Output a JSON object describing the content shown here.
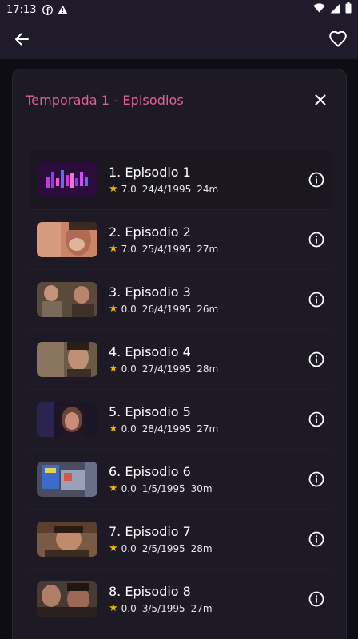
{
  "status": {
    "time": "17:13"
  },
  "sheet": {
    "title": "Temporada 1 - Episodios"
  },
  "episodes": [
    {
      "title": "1. Episodio 1",
      "rating": "7.0",
      "date": "24/4/1995",
      "duration": "24m"
    },
    {
      "title": "2. Episodio 2",
      "rating": "7.0",
      "date": "25/4/1995",
      "duration": "27m"
    },
    {
      "title": "3. Episodio 3",
      "rating": "0.0",
      "date": "26/4/1995",
      "duration": "26m"
    },
    {
      "title": "4. Episodio 4",
      "rating": "0.0",
      "date": "27/4/1995",
      "duration": "28m"
    },
    {
      "title": "5. Episodio 5",
      "rating": "0.0",
      "date": "28/4/1995",
      "duration": "27m"
    },
    {
      "title": "6. Episodio 6",
      "rating": "0.0",
      "date": "1/5/1995",
      "duration": "30m"
    },
    {
      "title": "7. Episodio 7",
      "rating": "0.0",
      "date": "2/5/1995",
      "duration": "28m"
    },
    {
      "title": "8. Episodio 8",
      "rating": "0.0",
      "date": "3/5/1995",
      "duration": "27m"
    }
  ],
  "colors": {
    "accent": "#e0609a",
    "star": "#f2b400",
    "appbar": "#201b2b",
    "sheet": "#1e1a25"
  },
  "icons": [
    "back-arrow-icon",
    "heart-icon",
    "close-icon",
    "info-icon",
    "star-icon",
    "wifi-icon",
    "signal-icon",
    "battery-icon",
    "facebook-icon",
    "warning-icon"
  ]
}
